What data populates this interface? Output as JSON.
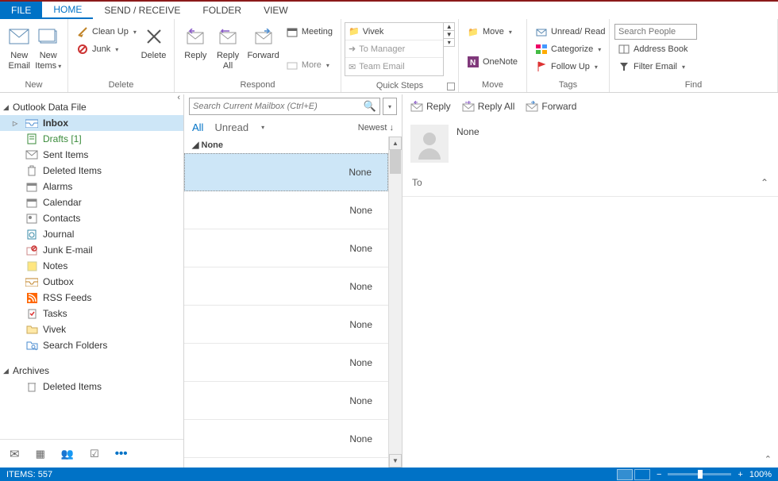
{
  "tabs": {
    "file": "FILE",
    "home": "HOME",
    "sendrecv": "SEND / RECEIVE",
    "folder": "FOLDER",
    "view": "VIEW"
  },
  "ribbon": {
    "new": {
      "label": "New",
      "email": "New\nEmail",
      "items": "New\nItems"
    },
    "delete": {
      "label": "Delete",
      "cleanup": "Clean Up",
      "junk": "Junk",
      "delete": "Delete"
    },
    "respond": {
      "label": "Respond",
      "reply": "Reply",
      "replyall": "Reply\nAll",
      "forward": "Forward",
      "meeting": "Meeting",
      "more": "More"
    },
    "quicksteps": {
      "label": "Quick Steps",
      "vivek": "Vivek",
      "manager": "To Manager",
      "team": "Team Email"
    },
    "move": {
      "label": "Move",
      "move": "Move",
      "onenote": "OneNote"
    },
    "tags": {
      "label": "Tags",
      "unread": "Unread/ Read",
      "categorize": "Categorize",
      "followup": "Follow Up"
    },
    "find": {
      "label": "Find",
      "search_ph": "Search People",
      "addressbook": "Address Book",
      "filter": "Filter Email"
    }
  },
  "nav": {
    "root": "Outlook Data File",
    "items": [
      {
        "label": "Inbox"
      },
      {
        "label": "Drafts [1]"
      },
      {
        "label": "Sent Items"
      },
      {
        "label": "Deleted Items"
      },
      {
        "label": "Alarms"
      },
      {
        "label": "Calendar"
      },
      {
        "label": "Contacts"
      },
      {
        "label": "Journal"
      },
      {
        "label": "Junk E-mail"
      },
      {
        "label": "Notes"
      },
      {
        "label": "Outbox"
      },
      {
        "label": "RSS Feeds"
      },
      {
        "label": "Tasks"
      },
      {
        "label": "Vivek"
      },
      {
        "label": "Search Folders"
      }
    ],
    "archives": "Archives",
    "archives_deleted": "Deleted Items",
    "switch_more": "•••"
  },
  "msglist": {
    "search_ph": "Search Current Mailbox (Ctrl+E)",
    "all": "All",
    "unread": "Unread",
    "arrange": "Newest",
    "group": "None",
    "items": [
      "None",
      "None",
      "None",
      "None",
      "None",
      "None",
      "None",
      "None"
    ]
  },
  "reading": {
    "reply": "Reply",
    "replyall": "Reply All",
    "forward": "Forward",
    "subject": "None",
    "to_label": "To"
  },
  "status": {
    "items": "ITEMS: 557",
    "zoom": "100%"
  }
}
